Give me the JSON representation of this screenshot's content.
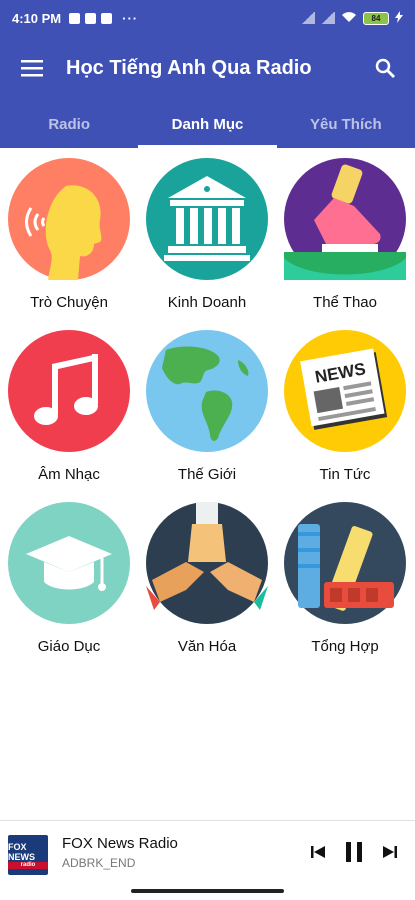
{
  "status_bar": {
    "time": "4:10 PM",
    "overflow": "···",
    "battery": "84"
  },
  "app_bar": {
    "title": "Học Tiếng Anh Qua Radio",
    "menu_icon": "hamburger-menu-icon",
    "search_icon": "search-icon"
  },
  "tabs": [
    {
      "label": "Radio",
      "active": false
    },
    {
      "label": "Danh Mục",
      "active": true
    },
    {
      "label": "Yêu Thích",
      "active": false
    }
  ],
  "categories": [
    {
      "label": "Trò Chuyện",
      "icon": "speaking-head-icon",
      "color": "#ff7f64"
    },
    {
      "label": "Kinh Doanh",
      "icon": "bank-building-icon",
      "color": "#1aa39a"
    },
    {
      "label": "Thể Thao",
      "icon": "running-shoe-icon",
      "color": "#5e2d91"
    },
    {
      "label": "Âm Nhạc",
      "icon": "music-note-icon",
      "color": "#f03e4f"
    },
    {
      "label": "Thế Giới",
      "icon": "globe-icon",
      "color": "#79c6ef"
    },
    {
      "label": "Tin Tức",
      "icon": "newspaper-icon",
      "color": "#ffcb05"
    },
    {
      "label": "Giáo Dục",
      "icon": "graduation-cap-icon",
      "color": "#7fd3c2"
    },
    {
      "label": "Văn Hóa",
      "icon": "joined-hands-icon",
      "color": "#2c3e50"
    },
    {
      "label": "Tổng Hợp",
      "icon": "color-palette-icon",
      "color": "#34495e"
    }
  ],
  "player": {
    "logo_text": "FOX NEWS",
    "logo_sub": "radio",
    "station_name": "FOX News Radio",
    "now_playing": "ADBRK_END",
    "prev_icon": "skip-previous-icon",
    "pause_icon": "pause-icon",
    "next_icon": "skip-next-icon"
  },
  "colors": {
    "primary": "#3f51b5"
  }
}
